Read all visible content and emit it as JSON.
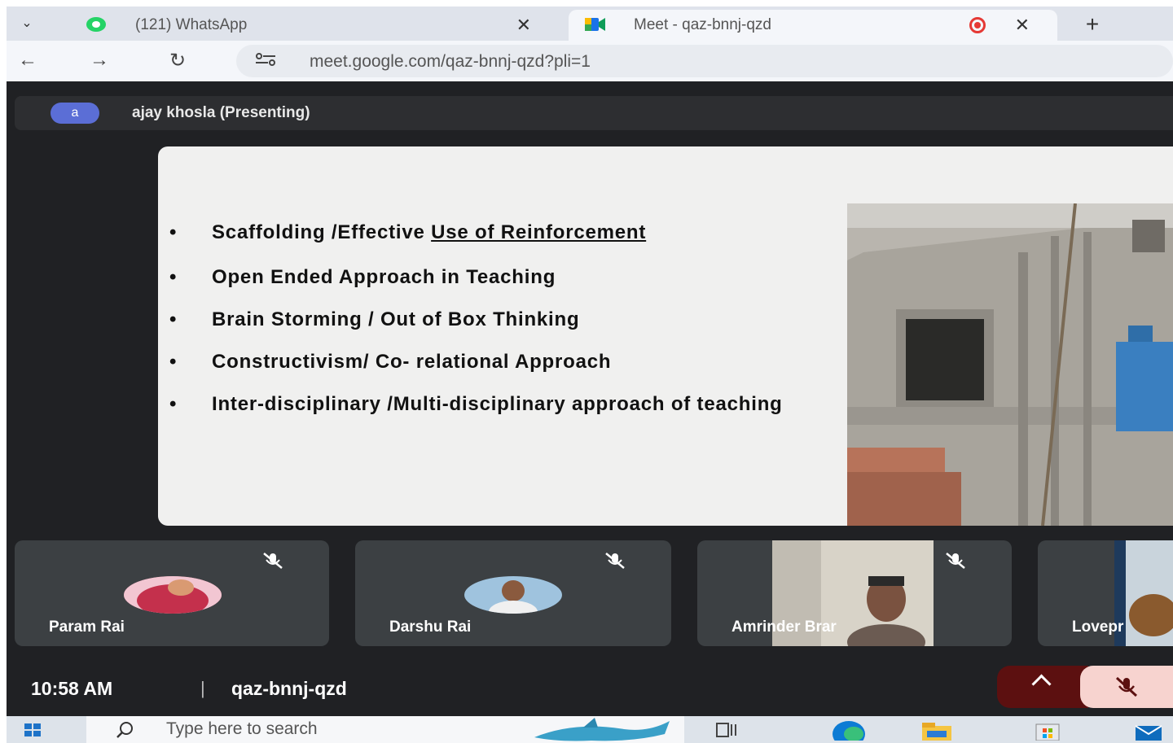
{
  "browser": {
    "tabs": [
      {
        "title": "(121) WhatsApp",
        "active": false,
        "favicon": "whatsapp-icon"
      },
      {
        "title": "Meet - qaz-bnnj-qzd",
        "active": true,
        "favicon": "google-meet-icon",
        "recording": true
      }
    ],
    "url": "meet.google.com/qaz-bnnj-qzd?pli=1",
    "icons": {
      "tab_menu": "chevron-down-icon",
      "back": "back-arrow-icon",
      "forward": "forward-arrow-icon",
      "reload": "reload-icon",
      "new_tab": "plus-icon",
      "site_info": "site-info-icon"
    }
  },
  "presenter": {
    "avatar_letter": "a",
    "label": "ajay khosla (Presenting)"
  },
  "slide": {
    "bullets": [
      {
        "text_plain": "Scaffolding /Effective ",
        "text_underlined": "Use of Reinforcement"
      },
      {
        "text_plain": "Open Ended Approach in Teaching",
        "text_underlined": ""
      },
      {
        "text_plain": "Brain Storming / Out of Box Thinking",
        "text_underlined": ""
      },
      {
        "text_plain": "Constructivism/ Co- relational Approach",
        "text_underlined": ""
      },
      {
        "text_plain": "Inter-disciplinary /Multi-disciplinary approach of teaching",
        "text_underlined": ""
      }
    ]
  },
  "participants": [
    {
      "name": "Param Rai",
      "muted": true
    },
    {
      "name": "Darshu Rai",
      "muted": true
    },
    {
      "name": "Amrinder Brar",
      "muted": true
    },
    {
      "name": "Lovepr",
      "muted": false
    }
  ],
  "footer": {
    "time": "10:58 AM",
    "separator": "|",
    "meeting_code": "qaz-bnnj-qzd"
  },
  "taskbar": {
    "search_placeholder": "Type here to search",
    "icons": [
      "windows-start-icon",
      "search-icon",
      "task-view-icon",
      "edge-icon",
      "file-explorer-icon",
      "microsoft-store-icon",
      "mail-icon"
    ]
  },
  "colors": {
    "meet_bg": "#202124",
    "tile_bg": "#3c4043",
    "accent_red": "#e53935",
    "mic_btn": "#f7d3cf"
  }
}
